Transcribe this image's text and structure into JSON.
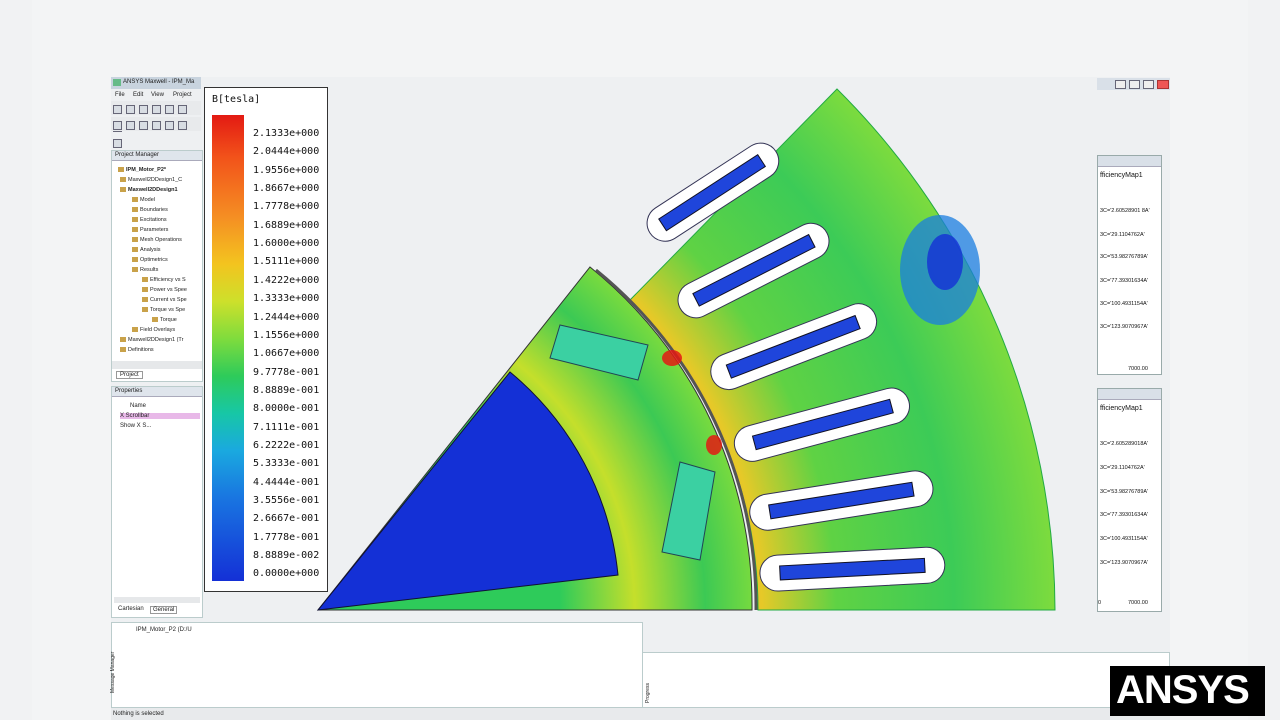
{
  "app": {
    "title": "ANSYS Maxwell - IPM_Ma",
    "menus": [
      "File",
      "Edit",
      "View",
      "Project"
    ]
  },
  "project_manager": {
    "title": "Project Manager",
    "tab": "Project",
    "items": [
      "IPM_Motor_P2*",
      "Maxwell2DDesign1_C",
      "Maxwell2DDesign1",
      "Model",
      "Boundaries",
      "Excitations",
      "Parameters",
      "Mesh Operations",
      "Analysis",
      "Optimetrics",
      "Results",
      "Efficiency vs S",
      "Power vs Spee",
      "Current vs Spe",
      "Torque vs Spe",
      "Torque",
      "Field Overlays",
      "Maxwell2DDesign1 (Tr",
      "Definitions"
    ]
  },
  "properties": {
    "title": "Properties",
    "column": "Name",
    "rows": [
      "X Scrollbar",
      "Show X S..."
    ],
    "tabs": [
      "Cartesian",
      "General"
    ]
  },
  "message_manager": {
    "label": "Message Manager",
    "entry": "IPM_Motor_P2 (D:/U"
  },
  "progress": {
    "label": "Progress"
  },
  "status_bar": {
    "text": "Nothing is selected"
  },
  "legend": {
    "title": "B[tesla]",
    "values": [
      "2.1333e+000",
      "2.0444e+000",
      "1.9556e+000",
      "1.8667e+000",
      "1.7778e+000",
      "1.6889e+000",
      "1.6000e+000",
      "1.5111e+000",
      "1.4222e+000",
      "1.3333e+000",
      "1.2444e+000",
      "1.1556e+000",
      "1.0667e+000",
      "9.7778e-001",
      "8.8889e-001",
      "8.0000e-001",
      "7.1111e-001",
      "6.2222e-001",
      "5.3333e-001",
      "4.4444e-001",
      "3.5556e-001",
      "2.6667e-001",
      "1.7778e-001",
      "8.8889e-002",
      "0.0000e+000"
    ],
    "colors": {
      "max": "#e31a13",
      "mid": "#2ecb5a",
      "min": "#1430d6"
    }
  },
  "right_window_1": {
    "title": "fficiencyMap1",
    "labels": [
      "3C='2.60528901 8A'",
      "3C='29.1104762A'",
      "3C='53.98276789A'",
      "3C='77.39301634A'",
      "3C='100.4931154A'",
      "3C='123.9070967A'"
    ],
    "axis_end": "7000.00"
  },
  "right_window_2": {
    "title": "fficiencyMap1",
    "labels": [
      "3C='2.605289018A'",
      "3C='29.1104762A'",
      "3C='53.98276789A'",
      "3C='77.39301634A'",
      "3C='100.4931154A'",
      "3C='123.9070967A'"
    ],
    "axis_start": "0",
    "axis_end": "7000.00"
  },
  "logo": {
    "text": "ANSYS"
  }
}
